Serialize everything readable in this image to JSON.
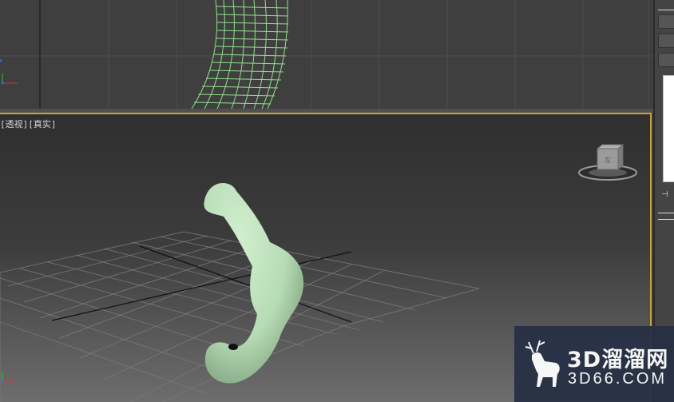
{
  "viewports": {
    "perspective": {
      "label_open": "[",
      "view_name": "透视",
      "label_mid": "][",
      "shading_mode": "真实",
      "label_close": "]"
    }
  },
  "viewcube": {
    "face_label": "左"
  },
  "watermark": {
    "brand": "3D溜溜网",
    "domain": "3D66.COM"
  },
  "colors": {
    "active_border": "#c9a43a",
    "wireframe": "#8fe08a",
    "object_surface": "#b9dfb7"
  }
}
